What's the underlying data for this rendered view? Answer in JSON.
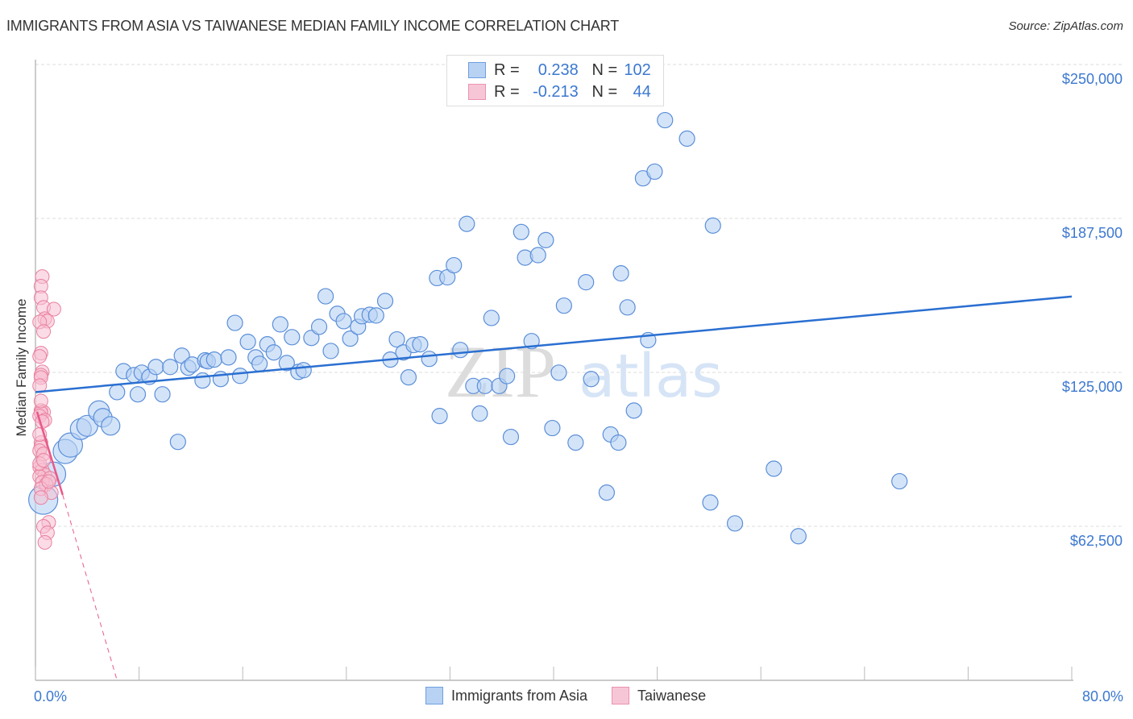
{
  "header": {
    "title": "IMMIGRANTS FROM ASIA VS TAIWANESE MEDIAN FAMILY INCOME CORRELATION CHART",
    "source": "Source: ZipAtlas.com"
  },
  "legend": {
    "rows": [
      {
        "r_label": "R =",
        "r_value": "0.238",
        "n_label": "N =",
        "n_value": "102"
      },
      {
        "r_label": "R =",
        "r_value": "-0.213",
        "n_label": "N =",
        "n_value": "44"
      }
    ]
  },
  "colors": {
    "blue_fill": "#b8d2f3",
    "blue_stroke": "#5b8fd9",
    "blue_line": "#2a6fd1",
    "pink_fill": "#f7bfd1",
    "pink_stroke": "#e9809f",
    "pink_line": "#e8598a",
    "tick_text": "#3c78d0",
    "watermark_zip": "#dcdcdc",
    "watermark_atlas": "#d6e4f6"
  },
  "watermark": {
    "zip": "ZIP",
    "atlas": "atlas"
  },
  "chart_data": {
    "type": "scatter",
    "title": "IMMIGRANTS FROM ASIA VS TAIWANESE MEDIAN FAMILY INCOME CORRELATION CHART",
    "xlabel": "",
    "ylabel": "Median Family Income",
    "xlim": [
      0,
      80
    ],
    "ylim": [
      0,
      262500
    ],
    "x_tick_labels": [
      "0.0%",
      "80.0%"
    ],
    "x_ticks": [
      0,
      8,
      16,
      24,
      32,
      40,
      48,
      56,
      64,
      72,
      80
    ],
    "y_ticks": [
      62500,
      125000,
      187500,
      250000
    ],
    "y_tick_labels": [
      "$62,500",
      "$125,000",
      "$187,500",
      "$250,000"
    ],
    "grid": true,
    "legend_position": "bottom-center",
    "series": [
      {
        "name": "Immigrants from Asia",
        "R": 0.238,
        "N": 102,
        "trend": {
          "x": [
            0,
            80
          ],
          "y": [
            117000,
            155800
          ]
        },
        "points": [
          [
            0.6,
            73300,
            3
          ],
          [
            1.4,
            83700,
            2.5
          ],
          [
            2.3,
            92900,
            2.5
          ],
          [
            2.7,
            95500,
            2.5
          ],
          [
            3.5,
            102000,
            2
          ],
          [
            4.0,
            103300,
            2
          ],
          [
            4.9,
            109200,
            2
          ],
          [
            5.2,
            106600,
            1.5
          ],
          [
            5.8,
            103300,
            1.5
          ],
          [
            6.3,
            117000,
            1
          ],
          [
            6.8,
            125500,
            1
          ],
          [
            7.6,
            123900,
            1
          ],
          [
            7.9,
            116100,
            1
          ],
          [
            8.2,
            124900,
            1
          ],
          [
            8.8,
            123200,
            1
          ],
          [
            9.3,
            127200,
            1
          ],
          [
            9.8,
            116100,
            1
          ],
          [
            10.4,
            127200,
            1
          ],
          [
            11.0,
            96800,
            1
          ],
          [
            11.3,
            131800,
            1
          ],
          [
            11.8,
            126900,
            1
          ],
          [
            12.1,
            128200,
            1
          ],
          [
            12.9,
            121700,
            1
          ],
          [
            13.1,
            129900,
            1
          ],
          [
            13.3,
            129500,
            1
          ],
          [
            13.8,
            130200,
            1
          ],
          [
            14.3,
            122300,
            1
          ],
          [
            14.9,
            131100,
            1
          ],
          [
            15.4,
            145100,
            1
          ],
          [
            15.8,
            123600,
            1
          ],
          [
            16.4,
            137400,
            1
          ],
          [
            17.0,
            131100,
            1
          ],
          [
            17.3,
            128500,
            1
          ],
          [
            17.9,
            136400,
            1
          ],
          [
            18.4,
            133100,
            1
          ],
          [
            18.9,
            144500,
            1
          ],
          [
            19.4,
            128800,
            1
          ],
          [
            19.8,
            139300,
            1
          ],
          [
            20.3,
            125200,
            1
          ],
          [
            20.7,
            125900,
            1
          ],
          [
            21.3,
            139000,
            1
          ],
          [
            21.9,
            143500,
            1
          ],
          [
            22.4,
            155900,
            1
          ],
          [
            22.8,
            133700,
            1
          ],
          [
            23.3,
            148800,
            1
          ],
          [
            23.8,
            145800,
            1
          ],
          [
            24.3,
            138700,
            1
          ],
          [
            24.9,
            143500,
            1
          ],
          [
            25.2,
            147800,
            1
          ],
          [
            25.8,
            148400,
            1
          ],
          [
            26.3,
            148100,
            1
          ],
          [
            27.0,
            154000,
            1
          ],
          [
            27.4,
            130200,
            1
          ],
          [
            27.9,
            138400,
            1
          ],
          [
            28.4,
            133100,
            1
          ],
          [
            28.8,
            123000,
            1
          ],
          [
            29.2,
            136100,
            1
          ],
          [
            29.7,
            136400,
            1
          ],
          [
            30.4,
            130500,
            1
          ],
          [
            31.2,
            107300,
            1
          ],
          [
            31.0,
            163300,
            1
          ],
          [
            31.8,
            163600,
            1
          ],
          [
            32.3,
            168500,
            1
          ],
          [
            32.8,
            134100,
            1
          ],
          [
            33.3,
            185300,
            1
          ],
          [
            33.8,
            119500,
            1
          ],
          [
            34.3,
            108300,
            1
          ],
          [
            34.7,
            119500,
            1
          ],
          [
            35.2,
            147100,
            1
          ],
          [
            35.8,
            119500,
            1
          ],
          [
            36.4,
            123500,
            1
          ],
          [
            36.7,
            98800,
            1
          ],
          [
            37.5,
            182000,
            1
          ],
          [
            37.8,
            171600,
            1
          ],
          [
            38.3,
            137700,
            1
          ],
          [
            38.8,
            172600,
            1
          ],
          [
            39.4,
            178700,
            1
          ],
          [
            39.9,
            102400,
            1
          ],
          [
            40.4,
            124900,
            1
          ],
          [
            40.8,
            152100,
            1
          ],
          [
            41.7,
            96500,
            1
          ],
          [
            42.5,
            161600,
            1
          ],
          [
            42.9,
            122300,
            1
          ],
          [
            44.1,
            76200,
            1
          ],
          [
            44.4,
            99800,
            1
          ],
          [
            45.0,
            96500,
            1
          ],
          [
            45.2,
            165200,
            1
          ],
          [
            45.7,
            151400,
            1
          ],
          [
            46.2,
            109500,
            1
          ],
          [
            47.3,
            138100,
            1
          ],
          [
            46.9,
            203800,
            1
          ],
          [
            47.8,
            206500,
            1
          ],
          [
            48.6,
            227400,
            1
          ],
          [
            50.3,
            219900,
            1
          ],
          [
            52.1,
            72200,
            1
          ],
          [
            52.3,
            184600,
            1
          ],
          [
            54.0,
            63700,
            1
          ],
          [
            57.0,
            85900,
            1
          ],
          [
            58.9,
            58500,
            1
          ],
          [
            66.7,
            80800,
            1
          ]
        ]
      },
      {
        "name": "Taiwanese",
        "R": -0.213,
        "N": 44,
        "trend": {
          "x": [
            0,
            2.1
          ],
          "y": [
            109000,
            75300
          ],
          "extended_to": [
            6.3,
            0
          ]
        },
        "points": [
          [
            0.4,
            163900
          ],
          [
            0.3,
            160000
          ],
          [
            0.3,
            155300
          ],
          [
            0.5,
            151400
          ],
          [
            1.3,
            150700
          ],
          [
            0.6,
            146800
          ],
          [
            0.8,
            145800
          ],
          [
            0.2,
            145500
          ],
          [
            0.5,
            141600
          ],
          [
            0.3,
            132800
          ],
          [
            0.2,
            131500
          ],
          [
            0.4,
            125200
          ],
          [
            0.3,
            123900
          ],
          [
            0.3,
            122900
          ],
          [
            0.2,
            119600
          ],
          [
            0.3,
            109500
          ],
          [
            0.5,
            108900
          ],
          [
            0.3,
            108600
          ],
          [
            0.2,
            107300
          ],
          [
            0.6,
            105600
          ],
          [
            0.4,
            105000
          ],
          [
            0.3,
            96500
          ],
          [
            0.3,
            94800
          ],
          [
            0.2,
            93200
          ],
          [
            0.5,
            91900
          ],
          [
            0.2,
            86600
          ],
          [
            0.4,
            85300
          ],
          [
            0.6,
            83400
          ],
          [
            0.2,
            82700
          ],
          [
            1.0,
            82000
          ],
          [
            0.4,
            80400
          ],
          [
            0.7,
            79500
          ],
          [
            0.3,
            77800
          ],
          [
            1.1,
            76200
          ],
          [
            0.3,
            74200
          ],
          [
            0.9,
            64100
          ],
          [
            0.5,
            62500
          ],
          [
            0.8,
            59900
          ],
          [
            0.6,
            56000
          ],
          [
            0.2,
            88000
          ],
          [
            0.2,
            99800
          ],
          [
            0.3,
            113400
          ],
          [
            0.5,
            89300
          ],
          [
            0.9,
            80700
          ]
        ]
      }
    ]
  }
}
